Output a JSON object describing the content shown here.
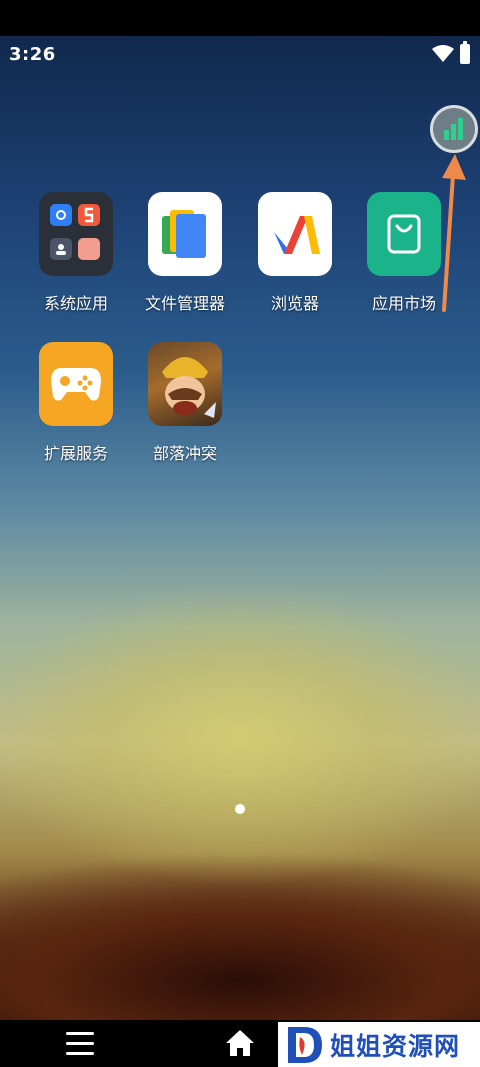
{
  "status_bar": {
    "time": "3:26",
    "icons": [
      "wifi-icon",
      "battery-icon"
    ]
  },
  "floating_button": {
    "icon": "bar-chart-icon"
  },
  "apps": [
    {
      "label": "系统应用",
      "icon": "folder-icon"
    },
    {
      "label": "文件管理器",
      "icon": "files-icon"
    },
    {
      "label": "浏览器",
      "icon": "browser-icon"
    },
    {
      "label": "应用市场",
      "icon": "app-market-icon"
    },
    {
      "label": "扩展服务",
      "icon": "gamepad-icon"
    },
    {
      "label": "部落冲突",
      "icon": "clash-of-clans-icon"
    }
  ],
  "page_indicator": {
    "current": 1,
    "total": 1
  },
  "nav_bar": {
    "icons": [
      "menu-icon",
      "home-icon"
    ]
  },
  "watermark": {
    "text": "姐姐资源网"
  },
  "colors": {
    "arrow": "#f08a4b",
    "market_green": "#1bb38a",
    "service_orange": "#f5a623"
  }
}
